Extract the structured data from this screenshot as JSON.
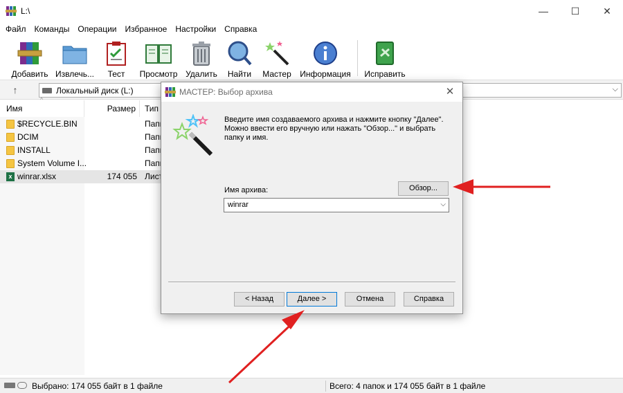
{
  "window": {
    "title": "L:\\",
    "minimize_label": "—",
    "maximize_label": "☐",
    "close_label": "✕"
  },
  "menu": [
    "Файл",
    "Команды",
    "Операции",
    "Избранное",
    "Настройки",
    "Справка"
  ],
  "toolbar": {
    "add": "Добавить",
    "extract": "Извлечь...",
    "test": "Тест",
    "view": "Просмотр",
    "delete": "Удалить",
    "find": "Найти",
    "wizard": "Мастер",
    "info": "Информация",
    "repair": "Исправить"
  },
  "address": {
    "up_label": "↑",
    "path": "Локальный диск (L:)",
    "chevron": "⌵"
  },
  "columns": {
    "name": "Имя",
    "size": "Размер",
    "type": "Тип"
  },
  "files": [
    {
      "name": "$RECYCLE.BIN",
      "size": "",
      "type": "Папк",
      "kind": "folder"
    },
    {
      "name": "DCIM",
      "size": "",
      "type": "Папк",
      "kind": "folder"
    },
    {
      "name": "INSTALL",
      "size": "",
      "type": "Папк",
      "kind": "folder"
    },
    {
      "name": "System Volume I...",
      "size": "",
      "type": "Папк",
      "kind": "folder"
    },
    {
      "name": "winrar.xlsx",
      "size": "174 055",
      "type": "Лист",
      "kind": "xlsx"
    }
  ],
  "status": {
    "left": "Выбрано: 174 055 байт в 1 файле",
    "right": "Всего: 4 папок и 174 055 байт в 1 файле"
  },
  "dialog": {
    "title": "МАСТЕР:  Выбор архива",
    "close_label": "✕",
    "instruction": "Введите имя создаваемого архива и нажмите кнопку \"Далее\". Можно ввести его вручную или нажать \"Обзор...\" и выбрать папку и имя.",
    "browse": "Обзор...",
    "archive_label": "Имя архива:",
    "archive_value": "winrar",
    "back": "< Назад",
    "next": "Далее >",
    "cancel": "Отмена",
    "help": "Справка"
  },
  "colors": {
    "annotation_arrow": "#e02020",
    "folder": "#f5c542",
    "xlsx": "#1e7145"
  }
}
